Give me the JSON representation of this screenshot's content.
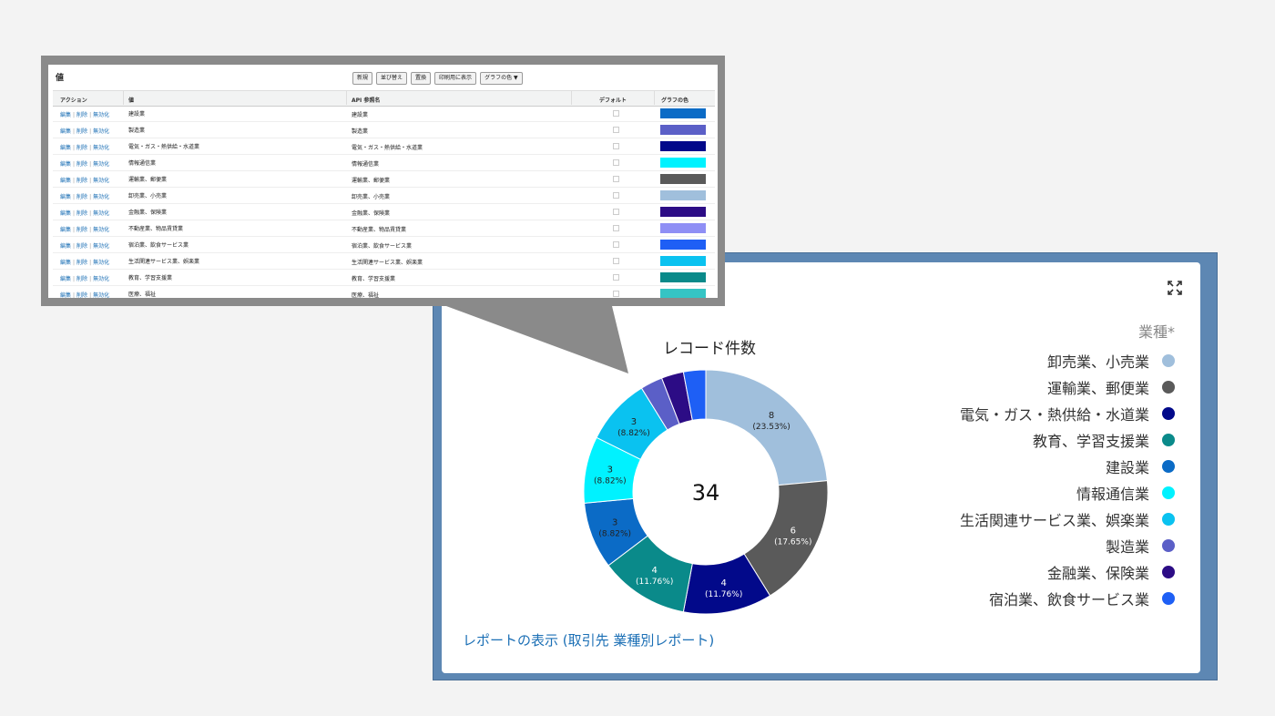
{
  "table": {
    "title": "値",
    "buttons": [
      "新規",
      "並び替え",
      "置換",
      "印刷用に表示",
      "グラフの色 ▼"
    ],
    "headers": {
      "action": "アクション",
      "value": "値",
      "api": "API 参照名",
      "default": "デフォルト",
      "color": "グラフの色"
    },
    "action_labels": [
      "編集",
      "削除",
      "無効化"
    ],
    "rows": [
      {
        "value": "建設業",
        "api": "建設業",
        "color": "#0b6bc6"
      },
      {
        "value": "製造業",
        "api": "製造業",
        "color": "#5b5fc7"
      },
      {
        "value": "電気・ガス・熱供給・水道業",
        "api": "電気・ガス・熱供給・水道業",
        "color": "#02098a"
      },
      {
        "value": "情報通信業",
        "api": "情報通信業",
        "color": "#00f2ff"
      },
      {
        "value": "運輸業、郵便業",
        "api": "運輸業、郵便業",
        "color": "#5a5a5a"
      },
      {
        "value": "卸売業、小売業",
        "api": "卸売業、小売業",
        "color": "#a0bfdc"
      },
      {
        "value": "金融業、保険業",
        "api": "金融業、保険業",
        "color": "#2c0c85"
      },
      {
        "value": "不動産業、物品賃貸業",
        "api": "不動産業、物品賃貸業",
        "color": "#8f8ff5"
      },
      {
        "value": "宿泊業、飲食サービス業",
        "api": "宿泊業、飲食サービス業",
        "color": "#1e5ff5"
      },
      {
        "value": "生活関連サービス業、娯楽業",
        "api": "生活関連サービス業、娯楽業",
        "color": "#0ac2f0"
      },
      {
        "value": "教育、学習支援業",
        "api": "教育、学習支援業",
        "color": "#0a8a8a"
      },
      {
        "value": "医療、福祉",
        "api": "医療、福祉",
        "color": "#35c4c4"
      }
    ]
  },
  "dashboard": {
    "chart_title": "レコード件数",
    "total": "34",
    "legend_title": "業種*",
    "report_link": "レポートの表示 (取引先 業種別レポート)"
  },
  "chart_data": {
    "type": "pie",
    "title": "レコード件数",
    "center_label": "34",
    "series": [
      {
        "name": "卸売業、小売業",
        "value": 8,
        "label": "(23.53%)",
        "color": "#a0bfdc"
      },
      {
        "name": "運輸業、郵便業",
        "value": 6,
        "label": "(17.65%)",
        "color": "#5a5a5a"
      },
      {
        "name": "電気・ガス・熱供給・水道業",
        "value": 4,
        "label": "(11.76%)",
        "color": "#02098a"
      },
      {
        "name": "教育、学習支援業",
        "value": 4,
        "label": "(11.76%)",
        "color": "#0a8a8a"
      },
      {
        "name": "建設業",
        "value": 3,
        "label": "(8.82%)",
        "color": "#0b6bc6"
      },
      {
        "name": "情報通信業",
        "value": 3,
        "label": "(8.82%)",
        "color": "#00f2ff"
      },
      {
        "name": "生活関連サービス業、娯楽業",
        "value": 3,
        "label": "(8.82%)",
        "color": "#0ac2f0"
      },
      {
        "name": "製造業",
        "value": 1,
        "label": "",
        "color": "#5b5fc7"
      },
      {
        "name": "金融業、保険業",
        "value": 1,
        "label": "",
        "color": "#2c0c85"
      },
      {
        "name": "宿泊業、飲食サービス業",
        "value": 1,
        "label": "",
        "color": "#1e5ff5"
      }
    ],
    "legend_placement": "right"
  }
}
